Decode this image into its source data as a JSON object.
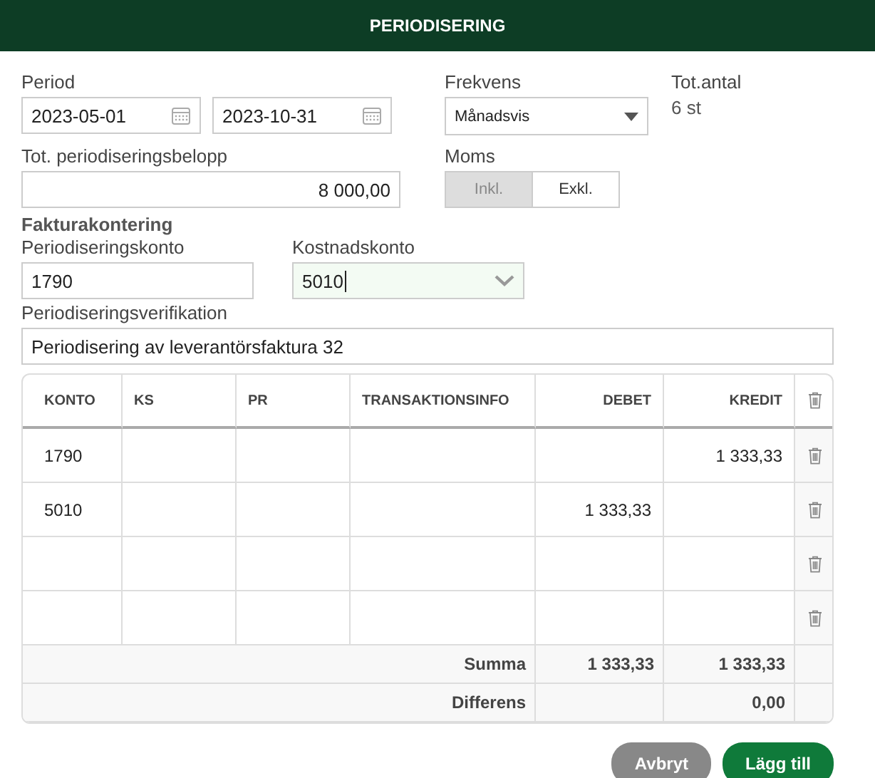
{
  "window": {
    "title": "PERIODISERING"
  },
  "period": {
    "label": "Period",
    "from": "2023-05-01",
    "to": "2023-10-31"
  },
  "frequency": {
    "label": "Frekvens",
    "value": "Månadsvis"
  },
  "total_count": {
    "label": "Tot.antal",
    "value": "6 st"
  },
  "total_amount": {
    "label": "Tot. periodiseringsbelopp",
    "value": "8 000,00"
  },
  "vat": {
    "label": "Moms",
    "options": [
      {
        "label": "Inkl.",
        "selected": true
      },
      {
        "label": "Exkl.",
        "selected": false
      }
    ]
  },
  "section_title": "Fakturakontering",
  "accrual_account": {
    "label": "Periodiseringskonto",
    "value": "1790"
  },
  "cost_account": {
    "label": "Kostnadskonto",
    "value": "5010",
    "focused": true
  },
  "verification": {
    "label": "Periodiseringsverifikation",
    "value": "Periodisering av leverantörsfaktura 32"
  },
  "table": {
    "columns": [
      "KONTO",
      "KS",
      "PR",
      "TRANSAKTIONSINFO",
      "DEBET",
      "KREDIT"
    ],
    "rows": [
      [
        "1790",
        "",
        "",
        "",
        "",
        "1 333,33"
      ],
      [
        "5010",
        "",
        "",
        "",
        "1 333,33",
        ""
      ],
      [
        "",
        "",
        "",
        "",
        "",
        ""
      ],
      [
        "",
        "",
        "",
        "",
        "",
        ""
      ]
    ],
    "totals": [
      {
        "label": "Summa",
        "debit": "1 333,33",
        "credit": "1 333,33"
      },
      {
        "label": "Differens",
        "credit": "0,00"
      }
    ]
  },
  "buttons": [
    {
      "label": "Avbryt",
      "kind": "secondary"
    },
    {
      "label": "Lägg till",
      "kind": "primary"
    }
  ]
}
